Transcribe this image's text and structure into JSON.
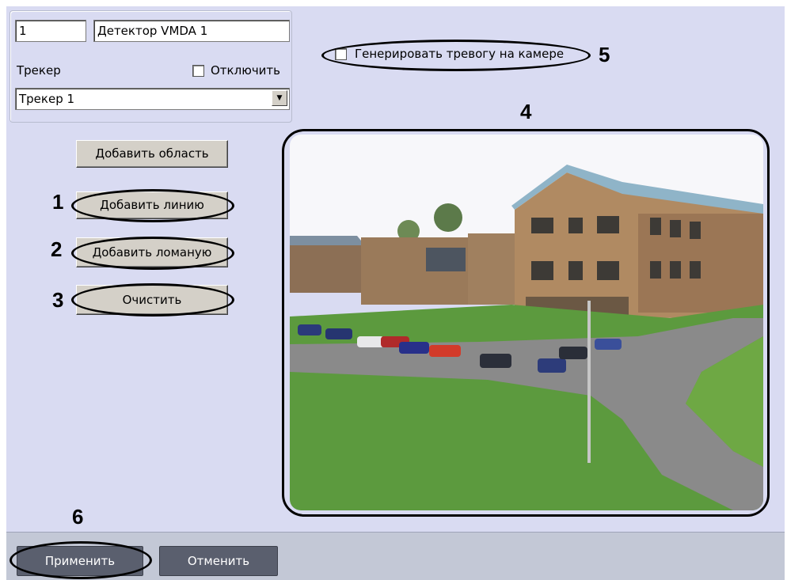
{
  "detector": {
    "id_value": "1",
    "name_value": "Детектор VMDA 1",
    "tracker_label": "Трекер",
    "disable_label": "Отключить",
    "tracker_select_value": "Трекер 1"
  },
  "alarm_checkbox_label": "Генерировать тревогу на камере",
  "buttons": {
    "add_area": "Добавить область",
    "add_line": "Добавить линию",
    "add_polyline": "Добавить ломаную",
    "clear": "Очистить",
    "apply": "Применить",
    "cancel": "Отменить"
  },
  "callouts": {
    "n1": "1",
    "n2": "2",
    "n3": "3",
    "n4": "4",
    "n5": "5",
    "n6": "6"
  },
  "colors": {
    "panel_bg": "#d9dbf2",
    "bottom_bar_bg": "#c3c8d6",
    "dark_button": "#5a5f6e"
  }
}
